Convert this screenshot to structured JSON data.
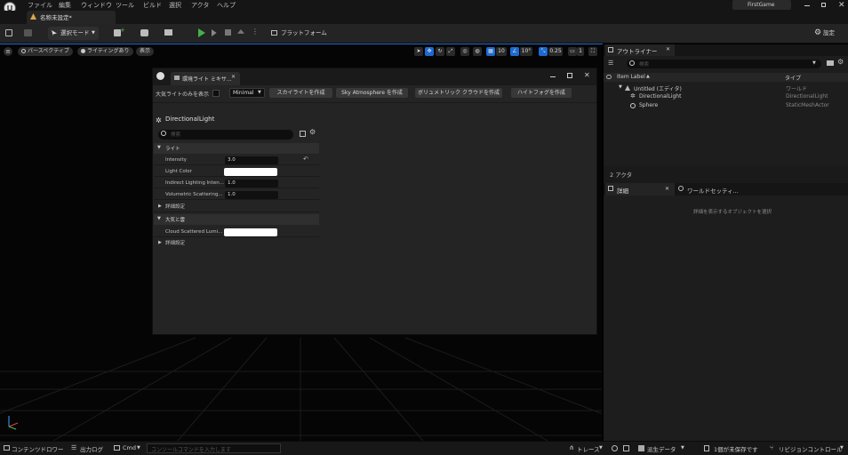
{
  "menu": [
    "ファイル",
    "編集",
    "ウィンドウ",
    "ツール",
    "ビルド",
    "選択",
    "アクタ",
    "ヘルプ"
  ],
  "project_name": "FirstGame",
  "document_tab": "名称未設定*",
  "toolbar": {
    "select_mode": "選択モード",
    "platforms": "プラットフォーム",
    "settings": "設定"
  },
  "viewport": {
    "perspective": "パースペクティブ",
    "lighting": "ライティングあり",
    "show": "表示",
    "grid_snap": "10",
    "rot_snap": "10°",
    "scale_snap": "0.25",
    "camera_speed": "1"
  },
  "mixer": {
    "tab_title": "環境ライト ミキサ...",
    "only_atmo_label": "大気ライトのみを表示",
    "filter_value": "Minimal",
    "buttons": [
      "スカイライトを作成",
      "Sky Atmosphere を作成",
      "ボリュメトリック クラウドを作成",
      "ハイトフォグを作成"
    ],
    "actor_name": "DirectionalLight",
    "search_placeholder": "検索",
    "cat_light": "ライト",
    "props": [
      {
        "label": "Intensity",
        "value": "3.0"
      },
      {
        "label": "Light Color",
        "value": ""
      },
      {
        "label": "Indirect Lighting Inten...",
        "value": "1.0"
      },
      {
        "label": "Volumetric Scattering...",
        "value": "1.0"
      }
    ],
    "advanced1": "詳細設定",
    "cat_atmosphere": "大気と雲",
    "cloud_label": "Cloud Scattered Lumi...",
    "advanced2": "詳細設定"
  },
  "outliner": {
    "tab": "アウトライナー",
    "search_placeholder": "検索",
    "col_label": "Item Label",
    "col_type": "タイプ",
    "rows": [
      {
        "label": "Untitled (エディタ)",
        "type": "ワールド"
      },
      {
        "label": "DirectionalLight",
        "type": "DirectionalLight"
      },
      {
        "label": "Sphere",
        "type": "StaticMeshActor"
      }
    ],
    "count": "2 アクタ"
  },
  "details": {
    "tab": "詳細",
    "world_tab": "ワールドセッティ...",
    "empty_msg": "詳細を表示するオブジェクトを選択"
  },
  "bottom": {
    "content_drawer": "コンテンツドロワー",
    "output_log": "出力ログ",
    "cmd": "Cmd",
    "console_placeholder": "コンソールコマンドを入力します",
    "trace": "トレース",
    "derived_data": "派生データ",
    "unsaved": "1個が未保存です",
    "revision": "リビジョンコントロール"
  },
  "colors": {
    "accent": "#1d6ad1",
    "play": "#46b04a",
    "bg": "#242424"
  }
}
